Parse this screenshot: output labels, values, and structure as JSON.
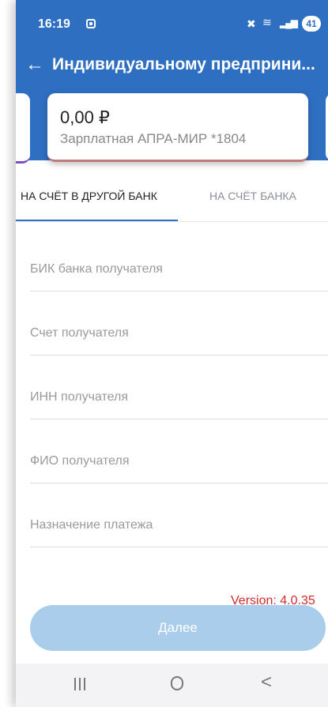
{
  "status_bar": {
    "time": "16:19",
    "battery": "41",
    "icons": [
      "screen-record-icon",
      "mute-icon",
      "wifi-icon",
      "signal-icon",
      "battery-icon"
    ]
  },
  "toolbar": {
    "back_icon": "←",
    "title": "Индивидуальному предприни..."
  },
  "account_card": {
    "amount": "0,00 ₽",
    "name": "Зарплатная АПРА-МИР *1804"
  },
  "tabs": [
    {
      "label": "НА СЧЁТ В ДРУГОЙ БАНК",
      "active": true
    },
    {
      "label": "НА СЧЁТ БАНКА",
      "active": false
    }
  ],
  "form": {
    "fields": [
      {
        "label": "БИК банка получателя"
      },
      {
        "label": "Счет получателя"
      },
      {
        "label": "ИНН получателя"
      },
      {
        "label": "ФИО получателя"
      },
      {
        "label": "Назначение платежа"
      }
    ]
  },
  "version": "Version: 4.0.35",
  "next_button": {
    "label": "Далее"
  },
  "colors": {
    "primary": "#2f6fc2",
    "button_disabled": "#a9cdea",
    "version_text": "#d42a2a"
  }
}
